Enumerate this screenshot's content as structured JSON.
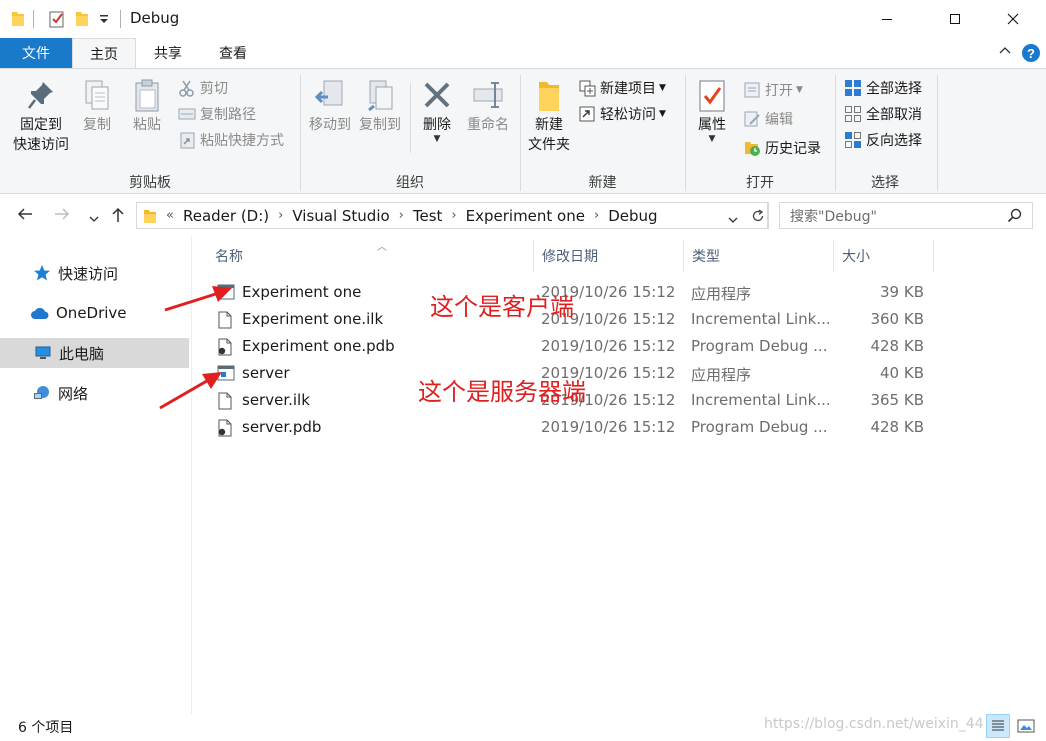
{
  "window": {
    "title": "Debug"
  },
  "ribbon_tabs": {
    "file": "文件",
    "home": "主页",
    "share": "共享",
    "view": "查看"
  },
  "ribbon": {
    "clipboard": {
      "label": "剪贴板",
      "pin_line1": "固定到",
      "pin_line2": "快速访问",
      "copy": "复制",
      "paste": "粘贴",
      "cut": "剪切",
      "copy_path": "复制路径",
      "paste_shortcut": "粘贴快捷方式"
    },
    "organize": {
      "label": "组织",
      "move_to": "移动到",
      "copy_to": "复制到",
      "delete": "删除",
      "rename": "重命名"
    },
    "new": {
      "label": "新建",
      "new_folder_line1": "新建",
      "new_folder_line2": "文件夹",
      "new_item": "新建项目",
      "easy_access": "轻松访问"
    },
    "open": {
      "label": "打开",
      "properties": "属性",
      "open": "打开",
      "edit": "编辑",
      "history": "历史记录"
    },
    "select": {
      "label": "选择",
      "select_all": "全部选择",
      "select_none": "全部取消",
      "invert": "反向选择"
    }
  },
  "address": {
    "overflow": "«",
    "crumbs": [
      "Reader (D:)",
      "Visual Studio",
      "Test",
      "Experiment one",
      "Debug"
    ],
    "search_placeholder": "搜索\"Debug\""
  },
  "nav": {
    "quick_access": "快速访问",
    "onedrive": "OneDrive",
    "this_pc": "此电脑",
    "network": "网络"
  },
  "columns": {
    "name": "名称",
    "date": "修改日期",
    "type": "类型",
    "size": "大小"
  },
  "files": [
    {
      "name": "Experiment one",
      "date": "2019/10/26 15:12",
      "type": "应用程序",
      "size": "39 KB",
      "icon": "app-icon"
    },
    {
      "name": "Experiment one.ilk",
      "date": "2019/10/26 15:12",
      "type": "Incremental Link...",
      "size": "360 KB",
      "icon": "file-icon"
    },
    {
      "name": "Experiment one.pdb",
      "date": "2019/10/26 15:12",
      "type": "Program Debug ...",
      "size": "428 KB",
      "icon": "pdb-icon"
    },
    {
      "name": "server",
      "date": "2019/10/26 15:12",
      "type": "应用程序",
      "size": "40 KB",
      "icon": "app-icon"
    },
    {
      "name": "server.ilk",
      "date": "2019/10/26 15:12",
      "type": "Incremental Link...",
      "size": "365 KB",
      "icon": "file-icon"
    },
    {
      "name": "server.pdb",
      "date": "2019/10/26 15:12",
      "type": "Program Debug ...",
      "size": "428 KB",
      "icon": "pdb-icon"
    }
  ],
  "annotations": {
    "client": "这个是客户端",
    "server": "这个是服务器端"
  },
  "status": {
    "count": "6 个项目",
    "watermark": "https://blog.csdn.net/weixin_44"
  },
  "colors": {
    "file_tab": "#1979ca",
    "annotation": "#e02020",
    "selected_nav": "#d9d9d9"
  }
}
